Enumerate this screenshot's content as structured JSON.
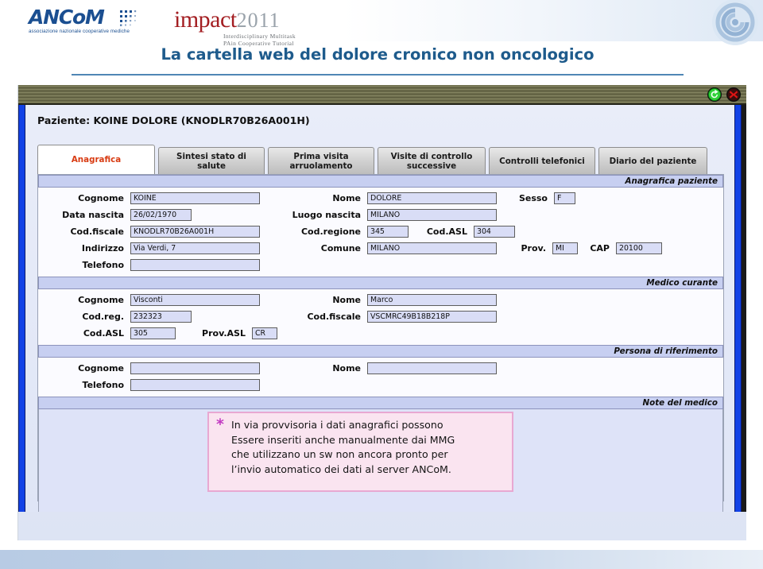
{
  "slide": {
    "title": "La  cartella web del dolore cronico non oncologico"
  },
  "logos": {
    "ancom_word": "ANCoM",
    "ancom_tagline": "associazione nazionale cooperative mediche",
    "impact_word": "impact",
    "impact_year": "2011",
    "impact_sub1": "Interdisciplinary Multitask",
    "impact_sub2": "PAin Cooperative Tutorial"
  },
  "window": {
    "controls": [
      {
        "name": "refresh-icon",
        "color": "#27c22e"
      },
      {
        "name": "close-icon",
        "color": "#cc1111"
      }
    ]
  },
  "app": {
    "patient_line": "Paziente: KOINE DOLORE (KNODLR70B26A001H)",
    "tabs": [
      {
        "label": "Anagrafica",
        "active": true
      },
      {
        "label": "Sintesi stato di salute",
        "active": false
      },
      {
        "label": "Prima visita\narruolamento",
        "active": false
      },
      {
        "label": "Visite di controllo\nsuccessive",
        "active": false
      },
      {
        "label": "Controlli telefonici",
        "active": false
      },
      {
        "label": "Diario del paziente",
        "active": false
      }
    ],
    "sections": {
      "anagrafica": {
        "title": "Anagrafica paziente",
        "fields": {
          "cognome_label": "Cognome",
          "cognome_value": "KOINE",
          "nome_label": "Nome",
          "nome_value": "DOLORE",
          "sesso_label": "Sesso",
          "sesso_value": "F",
          "data_nascita_label": "Data nascita",
          "data_nascita_value": "26/02/1970",
          "luogo_nascita_label": "Luogo nascita",
          "luogo_nascita_value": "MILANO",
          "cod_fiscale_label": "Cod.fiscale",
          "cod_fiscale_value": "KNODLR70B26A001H",
          "cod_regione_label": "Cod.regione",
          "cod_regione_value": "345",
          "cod_asl_label": "Cod.ASL",
          "cod_asl_value": "304",
          "indirizzo_label": "Indirizzo",
          "indirizzo_value": "Via Verdi, 7",
          "comune_label": "Comune",
          "comune_value": "MILANO",
          "prov_label": "Prov.",
          "prov_value": "MI",
          "cap_label": "CAP",
          "cap_value": "20100",
          "telefono_label": "Telefono",
          "telefono_value": ""
        }
      },
      "medico": {
        "title": "Medico curante",
        "fields": {
          "cognome_label": "Cognome",
          "cognome_value": "Visconti",
          "nome_label": "Nome",
          "nome_value": "Marco",
          "cod_reg_label": "Cod.reg.",
          "cod_reg_value": "232323",
          "cod_fiscale_label": "Cod.fiscale",
          "cod_fiscale_value": "VSCMRC49B18B218P",
          "cod_asl_label": "Cod.ASL",
          "cod_asl_value": "305",
          "prov_asl_label": "Prov.ASL",
          "prov_asl_value": "CR"
        }
      },
      "riferimento": {
        "title": "Persona di riferimento",
        "fields": {
          "cognome_label": "Cognome",
          "cognome_value": "",
          "nome_label": "Nome",
          "nome_value": "",
          "telefono_label": "Telefono",
          "telefono_value": ""
        }
      },
      "note": {
        "title": "Note del medico",
        "value": ""
      }
    }
  },
  "callout": {
    "star": "*",
    "text": "In via provvisoria i dati anagrafici possono\nEssere inseriti anche manualmente dai MMG\nche utilizzano un sw non ancora pronto per\nl’invio automatico dei dati al server ANCoM.",
    "border_color": "#e8a8d2",
    "background_color": "#fae4f0"
  },
  "colors": {
    "title_blue": "#1e5b8c",
    "ancom_blue": "#1b4f91",
    "impact_red": "#a31e22",
    "active_tab_text": "#d83b12",
    "rail_blue": "#1242e6",
    "section_bar": "#c7cff1"
  }
}
